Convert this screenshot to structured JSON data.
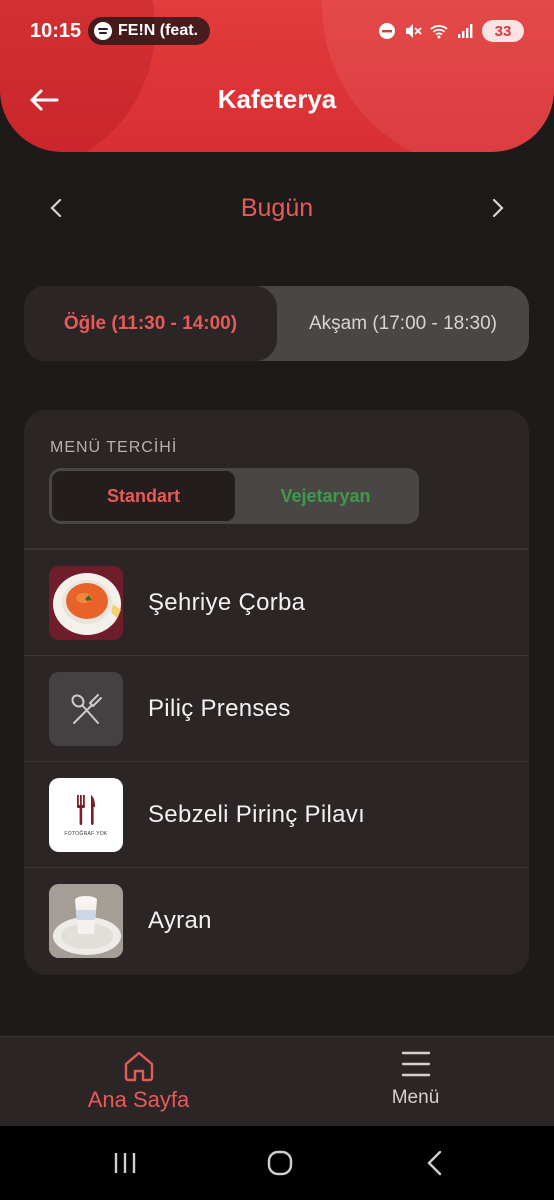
{
  "status_bar": {
    "time": "10:15",
    "media_text": "FE!N (feat.",
    "battery": "33"
  },
  "header": {
    "title": "Kafeterya",
    "back_icon": "arrow-left-icon"
  },
  "date_nav": {
    "label": "Bugün",
    "prev_icon": "chevron-left-icon",
    "next_icon": "chevron-right-icon"
  },
  "meal_tabs": [
    {
      "label": "Öğle (11:30 - 14:00)",
      "active": true
    },
    {
      "label": "Akşam (17:00 - 18:30)",
      "active": false
    }
  ],
  "menu_preference": {
    "label": "MENÜ TERCİHİ",
    "options": [
      {
        "label": "Standart",
        "active": true
      },
      {
        "label": "Vejetaryan",
        "active": false
      }
    ]
  },
  "menu_items": [
    {
      "name": "Şehriye Çorba",
      "image": "soup-photo"
    },
    {
      "name": "Piliç Prenses",
      "image": "fork-spoon-placeholder-icon"
    },
    {
      "name": "Sebzeli Pirinç Pilavı",
      "image": "no-photo-image",
      "image_text": "FOTOĞRAF YOK"
    },
    {
      "name": "Ayran",
      "image": "ayran-photo"
    }
  ],
  "bottom_nav": [
    {
      "label": "Ana Sayfa",
      "icon": "home-icon",
      "active": true
    },
    {
      "label": "Menü",
      "icon": "hamburger-menu-icon",
      "active": false
    }
  ],
  "colors": {
    "accent": "#e85a58",
    "header_red": "#dc3236",
    "background": "#1f1a1a",
    "card": "#2b2526",
    "vegetarian_green": "#3f9a4a"
  }
}
